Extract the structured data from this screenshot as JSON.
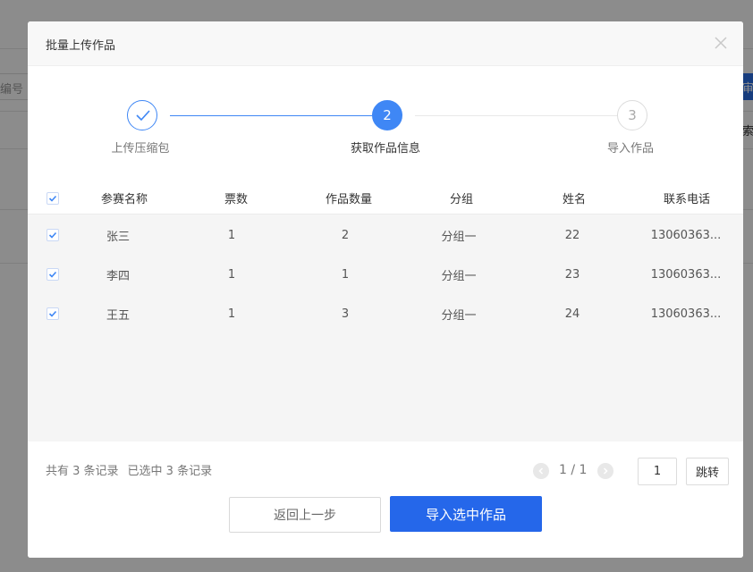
{
  "background": {
    "field_text": "编号",
    "button_text": "审",
    "side_text": "索"
  },
  "dialog": {
    "title": "批量上传作品"
  },
  "steps": [
    {
      "label": "上传压缩包",
      "number": "",
      "status": "done"
    },
    {
      "label": "获取作品信息",
      "number": "2",
      "status": "active"
    },
    {
      "label": "导入作品",
      "number": "3",
      "status": "pending"
    }
  ],
  "table": {
    "columns": [
      "参赛名称",
      "票数",
      "作品数量",
      "分组",
      "姓名",
      "联系电话"
    ],
    "rows": [
      {
        "name": "张三",
        "votes": "1",
        "works": "2",
        "group": "分组一",
        "person": "22",
        "phone": "13060363..."
      },
      {
        "name": "李四",
        "votes": "1",
        "works": "1",
        "group": "分组一",
        "person": "23",
        "phone": "13060363..."
      },
      {
        "name": "王五",
        "votes": "1",
        "works": "3",
        "group": "分组一",
        "person": "24",
        "phone": "13060363..."
      }
    ]
  },
  "footer": {
    "total_text": "共有 3 条记录",
    "selected_text": "已选中 3 条记录",
    "page_indicator": "1 / 1",
    "page_input_value": "1",
    "jump_label": "跳转",
    "back_label": "返回上一步",
    "import_label": "导入选中作品"
  },
  "colors": {
    "primary": "#2567ea",
    "step_active": "#3f87f5",
    "step_done_border": "#3f87f5",
    "text_dark": "#333333",
    "text_muted": "#777777"
  }
}
